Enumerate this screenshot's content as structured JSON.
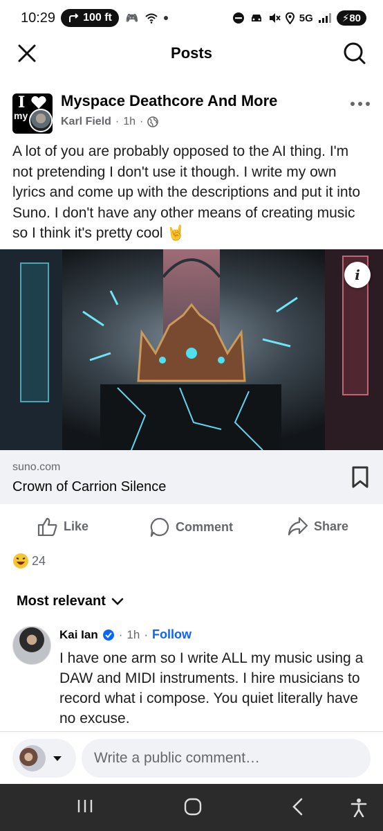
{
  "status_bar": {
    "time": "10:29",
    "nav_pill": "100 ft",
    "network": "5G",
    "battery": "80"
  },
  "topbar": {
    "title": "Posts"
  },
  "post": {
    "group_name": "Myspace Deathcore And More",
    "author": "Karl Field",
    "time": "1h",
    "text": "A lot of you are probably opposed to the AI thing. I'm not pretending I don't use it though. I write my own lyrics and come up with the descriptions and put it into Suno. I don't have any other means of creating music so I think it's pretty cool 🤘",
    "link_domain": "suno.com",
    "link_title": "Crown of Carrion Silence",
    "actions": {
      "like": "Like",
      "comment": "Comment",
      "share": "Share"
    },
    "reaction_count": "24"
  },
  "comments": {
    "sort_label": "Most relevant",
    "items": [
      {
        "name": "Kai Ian",
        "time": "1h",
        "follow": "Follow",
        "text": "I have one arm so I write ALL my music using a DAW and MIDI instruments. I hire musicians to record what i compose. You quiet literally have no excuse."
      }
    ]
  },
  "composer": {
    "placeholder": "Write a public comment…"
  },
  "colors": {
    "link_blue": "#0866ff",
    "secondary_text": "#65676b",
    "surface": "#f0f2f5",
    "nav_bar": "#2b2b2b"
  }
}
